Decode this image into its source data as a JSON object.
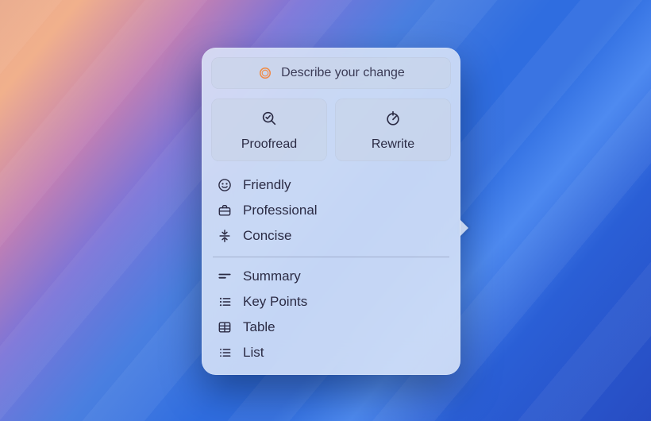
{
  "input": {
    "placeholder": "Describe your change"
  },
  "actions": {
    "proofread": "Proofread",
    "rewrite": "Rewrite"
  },
  "tone": {
    "friendly": "Friendly",
    "professional": "Professional",
    "concise": "Concise"
  },
  "format": {
    "summary": "Summary",
    "keypoints": "Key Points",
    "table": "Table",
    "list": "List"
  }
}
